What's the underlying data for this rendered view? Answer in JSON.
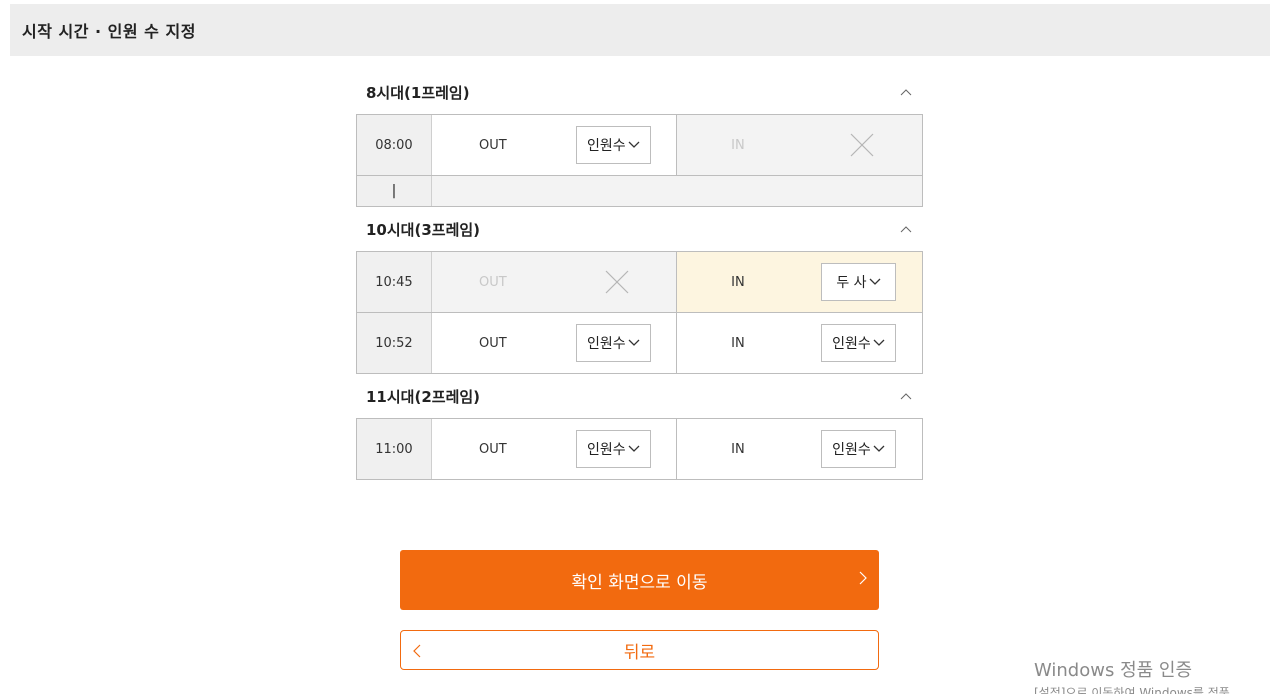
{
  "header": {
    "title": "시작 시간 · 인원 수 지정"
  },
  "sections": [
    {
      "title": "8시대(1프레임)",
      "rows": [
        {
          "time": "08:00",
          "out": {
            "label": "OUT",
            "select": "인원수"
          },
          "in": {
            "label": "IN"
          }
        }
      ],
      "sub_row": {
        "time": "|"
      }
    },
    {
      "title": "10시대(3프레임)",
      "rows": [
        {
          "time": "10:45",
          "out": {
            "label": "OUT"
          },
          "in": {
            "label": "IN",
            "select": "두 사"
          }
        },
        {
          "time": "10:52",
          "out": {
            "label": "OUT",
            "select": "인원수"
          },
          "in": {
            "label": "IN",
            "select": "인원수"
          }
        }
      ]
    },
    {
      "title": "11시대(2프레임)",
      "rows": [
        {
          "time": "11:00",
          "out": {
            "label": "OUT",
            "select": "인원수"
          },
          "in": {
            "label": "IN",
            "select": "인원수"
          }
        }
      ]
    }
  ],
  "buttons": {
    "confirm": "확인 화면으로 이동",
    "back": "뒤로"
  },
  "watermark": {
    "title": "Windows 정품 인증",
    "sub": "[설정]으로 이동하여 Windows를 정품"
  },
  "colors": {
    "accent": "#f26a0f",
    "highlight": "#fdf5e0",
    "header_bg": "#ededed"
  },
  "icons": {
    "collapse": "chevron-up-icon",
    "select": "chevron-down-icon",
    "unavailable": "close-icon"
  }
}
